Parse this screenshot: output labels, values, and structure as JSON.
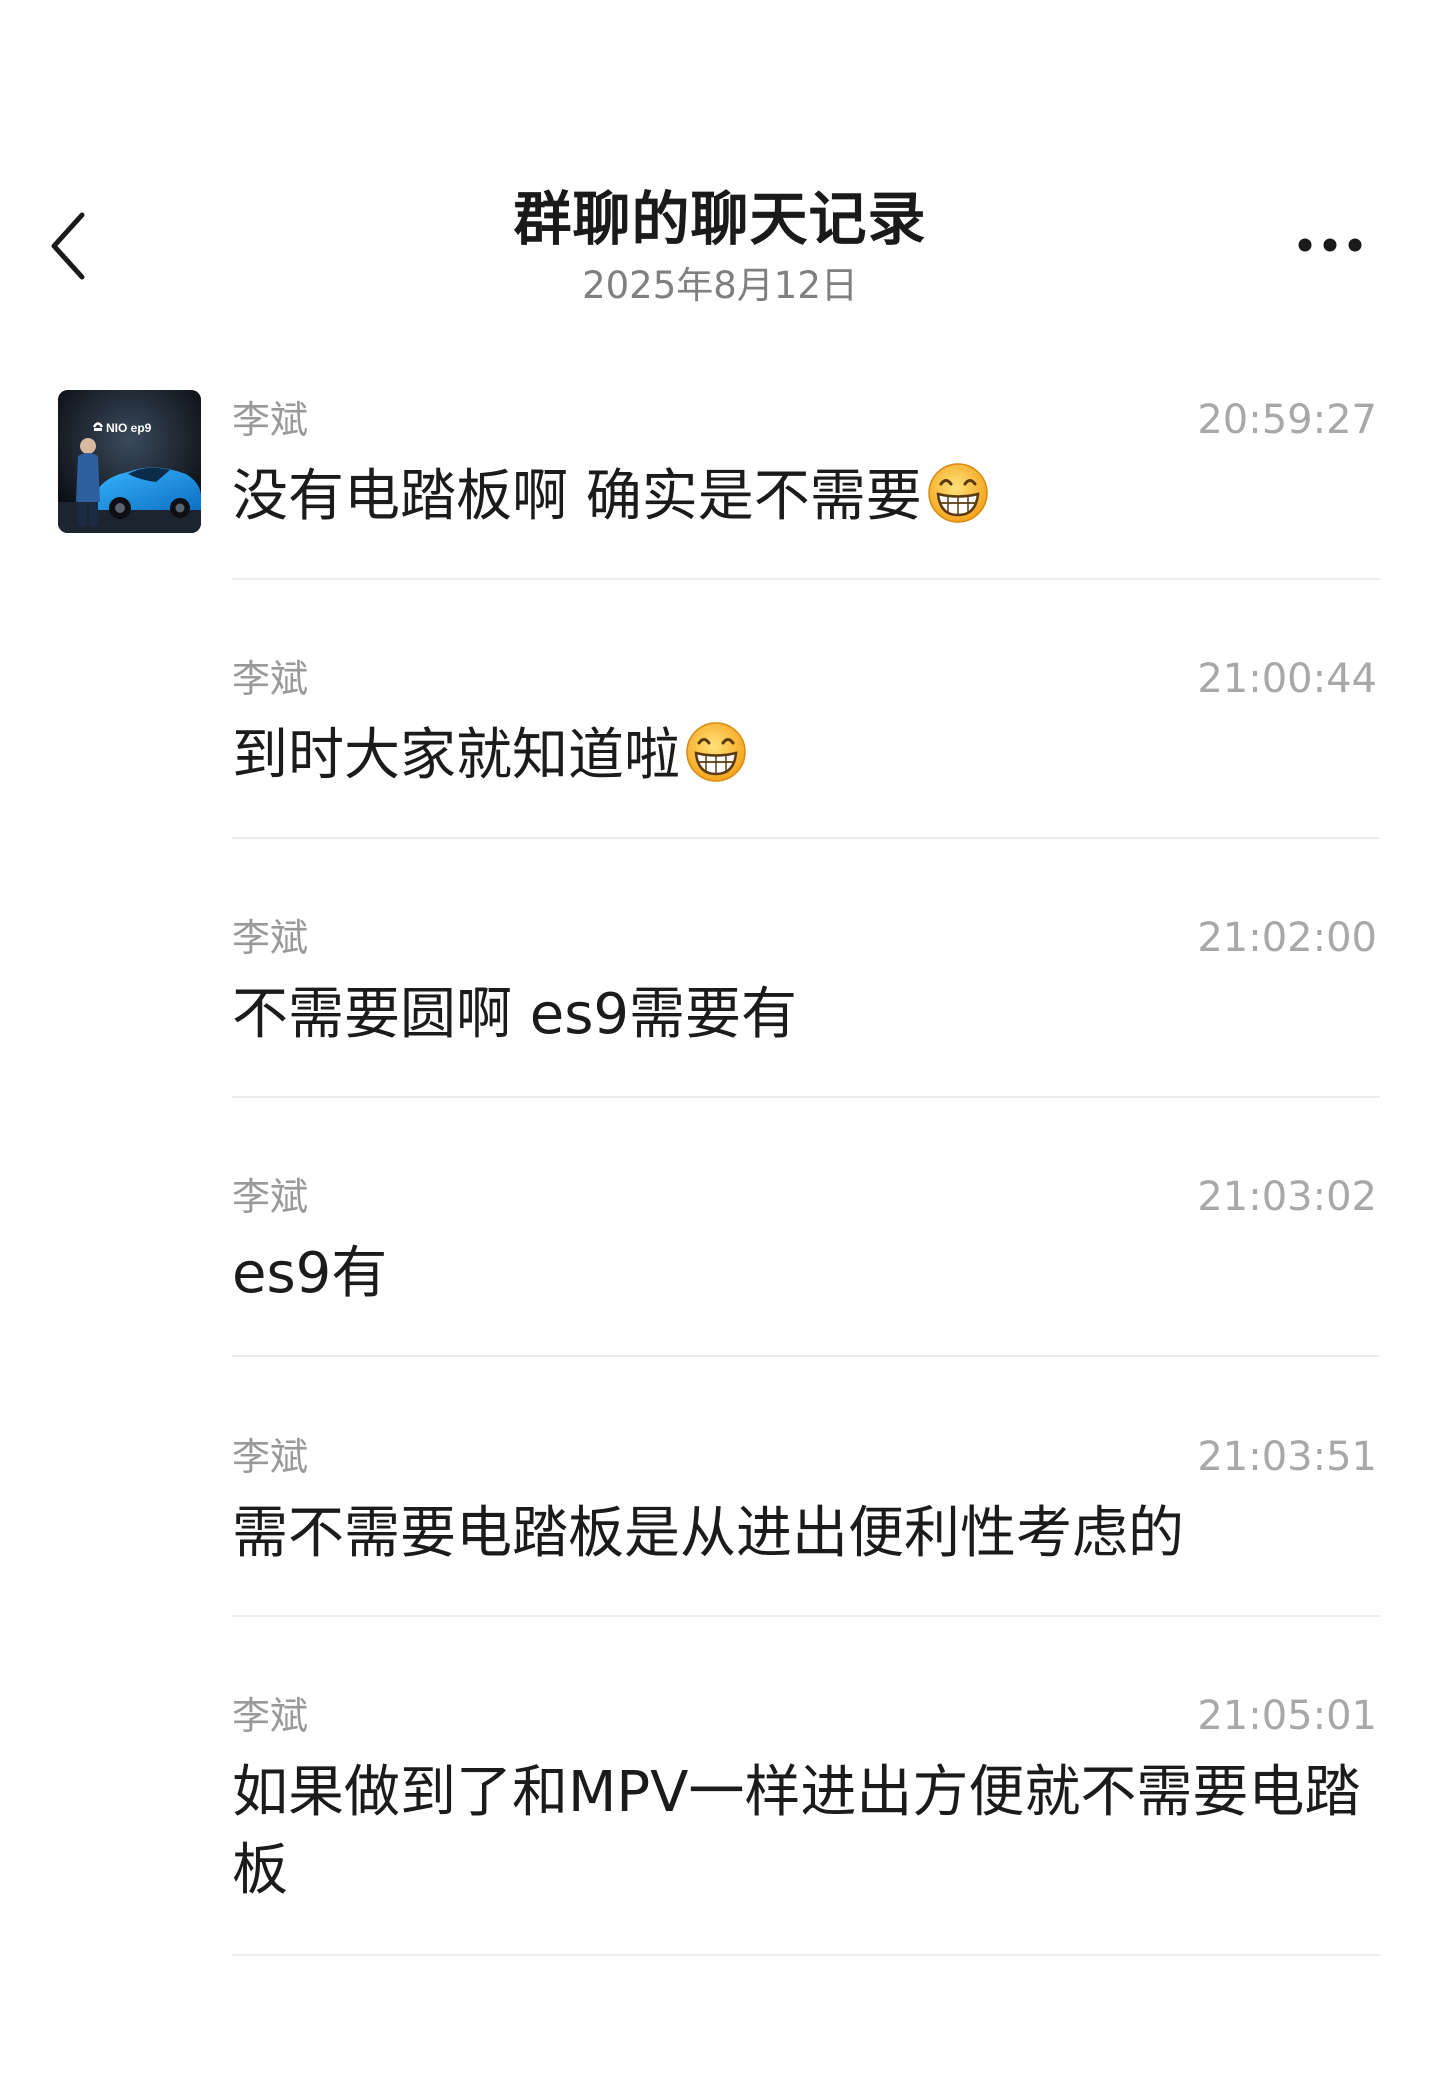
{
  "header": {
    "title": "群聊的聊天记录",
    "date": "2025年8月12日",
    "back_icon": "chevron-left-icon",
    "more_icon": "more-horizontal-icon"
  },
  "avatar": {
    "brand_text": "NIO ep9",
    "description_icon": "avatar-image"
  },
  "messages": [
    {
      "sender": "李斌",
      "time": "20:59:27",
      "text": "没有电踏板啊 确实是不需要",
      "emoji": "grinning-face-emoji"
    },
    {
      "sender": "李斌",
      "time": "21:00:44",
      "text": "到时大家就知道啦",
      "emoji": "grinning-face-emoji"
    },
    {
      "sender": "李斌",
      "time": "21:02:00",
      "text": "不需要圆啊 es9需要有",
      "emoji": ""
    },
    {
      "sender": "李斌",
      "time": "21:03:02",
      "text": "es9有",
      "emoji": ""
    },
    {
      "sender": "李斌",
      "time": "21:03:51",
      "text": "需不需要电踏板是从进出便利性考虑的",
      "emoji": ""
    },
    {
      "sender": "李斌",
      "time": "21:05:01",
      "text": "如果做到了和MPV一样进出方便就不需要电踏板",
      "emoji": ""
    }
  ],
  "colors": {
    "text_primary": "#1b1b1b",
    "text_secondary": "#999999",
    "divider": "#ececec",
    "background": "#ffffff"
  }
}
